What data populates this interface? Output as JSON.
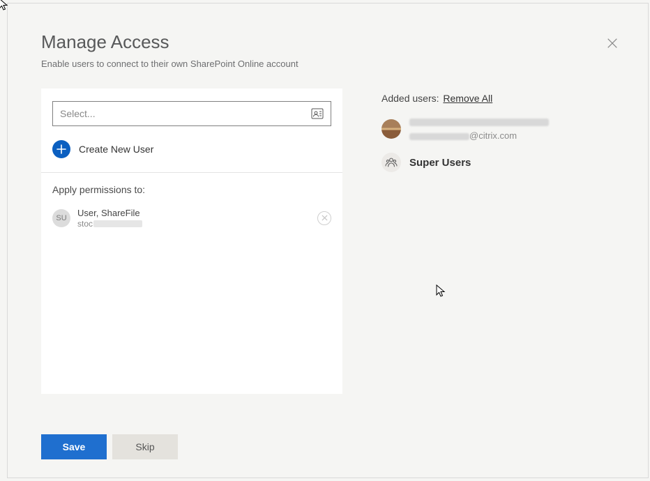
{
  "header": {
    "title": "Manage Access",
    "subtitle": "Enable users to connect to their own SharePoint Online account"
  },
  "left": {
    "select_placeholder": "Select...",
    "create_label": "Create New User",
    "apply_label": "Apply permissions to:",
    "permissions": [
      {
        "initials": "SU",
        "name": "User, ShareFile",
        "email_prefix": "stoc"
      }
    ]
  },
  "right": {
    "added_label": "Added users:",
    "remove_all_label": "Remove All",
    "users": [
      {
        "email_suffix": "@citrix.com"
      }
    ],
    "groups": [
      {
        "name": "Super Users"
      }
    ]
  },
  "footer": {
    "save_label": "Save",
    "skip_label": "Skip"
  }
}
